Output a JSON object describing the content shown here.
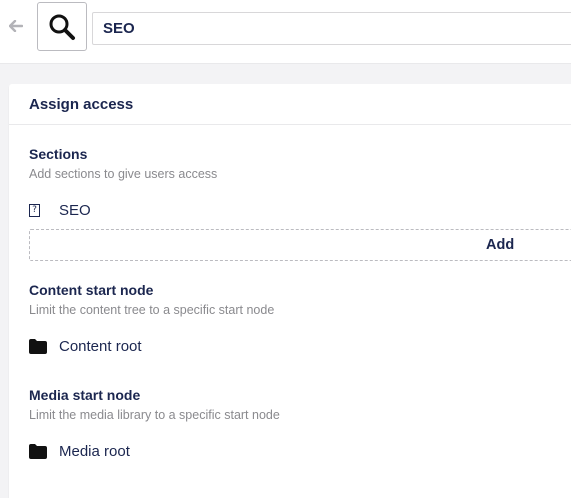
{
  "header": {
    "back_icon": "arrow-left-icon",
    "group_icon": "magnifier-icon",
    "name_value": "SEO"
  },
  "panel": {
    "title": "Assign access",
    "sections": {
      "label": "Sections",
      "description": "Add sections to give users access",
      "items": [
        {
          "icon": "unknown-icon",
          "icon_glyph": "?",
          "label": "SEO"
        }
      ],
      "add_label": "Add"
    },
    "content_start": {
      "label": "Content start node",
      "description": "Limit the content tree to a specific start node",
      "item": {
        "icon": "folder-icon",
        "label": "Content root"
      }
    },
    "media_start": {
      "label": "Media start node",
      "description": "Limit the media library to a specific start node",
      "item": {
        "icon": "folder-icon",
        "label": "Media root"
      }
    }
  },
  "colors": {
    "text": "#1b264f",
    "muted": "#8a8a8e",
    "background": "#f3f3f5",
    "border": "#e9e9eb"
  }
}
